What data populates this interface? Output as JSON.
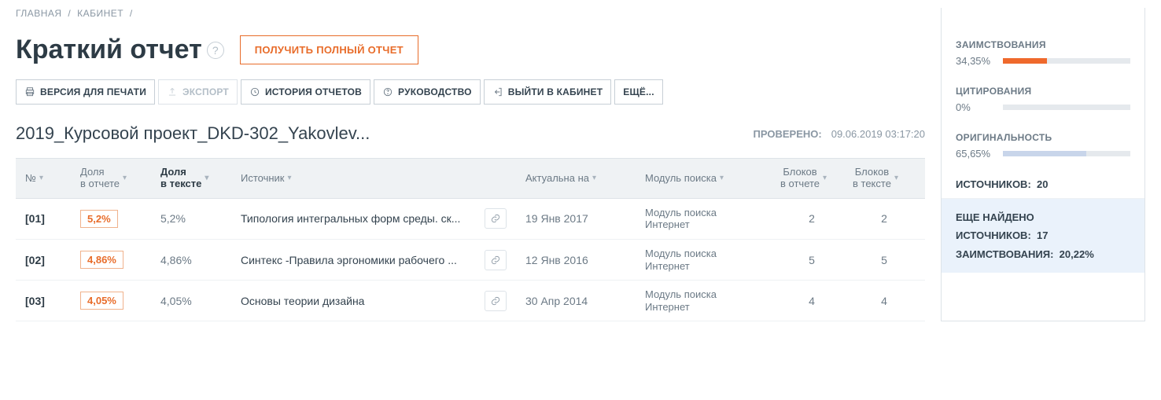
{
  "breadcrumbs": {
    "home": "ГЛАВНАЯ",
    "cabinet": "КАБИНЕТ"
  },
  "title": "Краткий отчет",
  "cta": "ПОЛУЧИТЬ ПОЛНЫЙ ОТЧЕТ",
  "toolbar": {
    "print": "ВЕРСИЯ ДЛЯ ПЕЧАТИ",
    "export": "ЭКСПОРТ",
    "history": "ИСТОРИЯ ОТЧЕТОВ",
    "guide": "РУКОВОДСТВО",
    "exit": "ВЫЙТИ В КАБИНЕТ",
    "more": "ЕЩЁ..."
  },
  "document_title": "2019_Курсовой проект_DKD-302_Yakovlev...",
  "checked": {
    "label": "ПРОВЕРЕНО:",
    "value": "09.06.2019 03:17:20"
  },
  "columns": {
    "num": "№",
    "share_report_l1": "Доля",
    "share_report_l2": "в отчете",
    "share_text_l1": "Доля",
    "share_text_l2": "в тексте",
    "source": "Источник",
    "actual_on": "Актуальна на",
    "module": "Модуль поиска",
    "blocks_report_l1": "Блоков",
    "blocks_report_l2": "в отчете",
    "blocks_text_l1": "Блоков",
    "blocks_text_l2": "в тексте"
  },
  "rows": [
    {
      "num": "[01]",
      "share_report": "5,2%",
      "share_text": "5,2%",
      "source": "Типология интегральных форм среды. ск...",
      "date": "19 Янв 2017",
      "module_l1": "Модуль поиска",
      "module_l2": "Интернет",
      "blocks_report": "2",
      "blocks_text": "2"
    },
    {
      "num": "[02]",
      "share_report": "4,86%",
      "share_text": "4,86%",
      "source": "Синтекс -Правила эргономики рабочего ...",
      "date": "12 Янв 2016",
      "module_l1": "Модуль поиска",
      "module_l2": "Интернет",
      "blocks_report": "5",
      "blocks_text": "5"
    },
    {
      "num": "[03]",
      "share_report": "4,05%",
      "share_text": "4,05%",
      "source": "Основы теории дизайна",
      "date": "30 Апр 2014",
      "module_l1": "Модуль поиска",
      "module_l2": "Интернет",
      "blocks_report": "4",
      "blocks_text": "4"
    }
  ],
  "stats": {
    "borrow_label": "ЗАИМСТВОВАНИЯ",
    "borrow_value": "34,35%",
    "borrow_pct": 34.35,
    "cite_label": "ЦИТИРОВАНИЯ",
    "cite_value": "0%",
    "cite_pct": 0,
    "orig_label": "ОРИГИНАЛЬНОСТЬ",
    "orig_value": "65,65%",
    "orig_pct": 65.65,
    "sources_label": "ИСТОЧНИКОВ:",
    "sources_value": "20",
    "extra_found_l1": "ЕЩЕ НАЙДЕНО",
    "extra_found_l2": "ИСТОЧНИКОВ:",
    "extra_found_value": "17",
    "extra_borrow_label": "ЗАИМСТВОВАНИЯ:",
    "extra_borrow_value": "20,22%"
  }
}
